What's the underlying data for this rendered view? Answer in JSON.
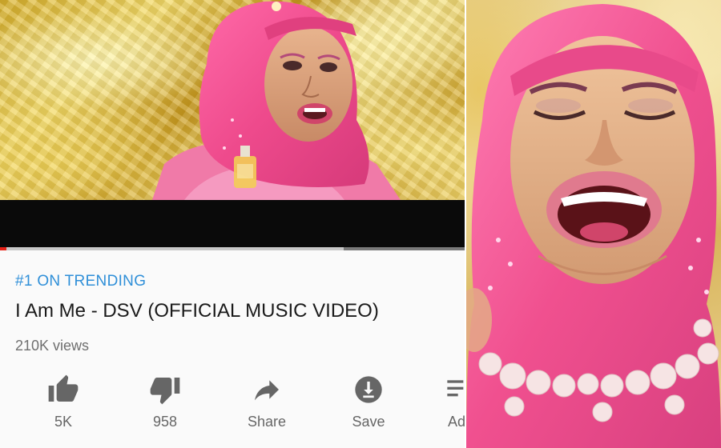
{
  "video": {
    "trending_label": "#1 ON TRENDING",
    "title": "I Am Me - DSV (OFFICIAL MUSIC VIDEO)",
    "views": "210K views",
    "progress_fraction": 0.005,
    "buffer_start_fraction": 0.74
  },
  "actions": [
    {
      "icon": "thumbs-up-icon",
      "label": "5K"
    },
    {
      "icon": "thumbs-down-icon",
      "label": "958"
    },
    {
      "icon": "share-arrow-icon",
      "label": "Share"
    },
    {
      "icon": "download-icon",
      "label": "Save"
    },
    {
      "icon": "add-to-playlist-icon",
      "label": "Ad"
    }
  ],
  "colors": {
    "accent_blue": "#2f8fd8",
    "progress_red": "#e62117",
    "hijab_pink": "#f0508f"
  }
}
